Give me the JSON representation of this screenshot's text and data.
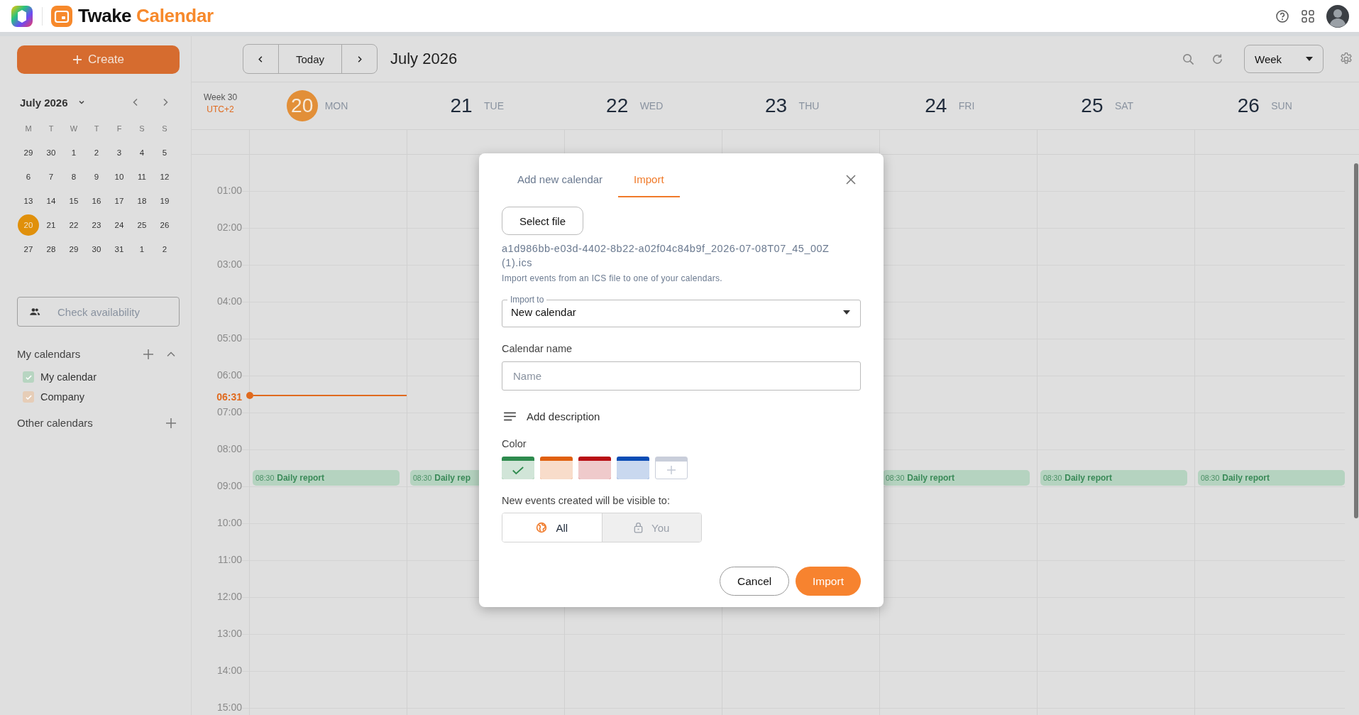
{
  "app": {
    "brand": "Twake",
    "product": "Calendar"
  },
  "sidebar": {
    "create_label": "Create",
    "mini_calendar": {
      "title": "July 2026",
      "weekdays": [
        "M",
        "T",
        "W",
        "T",
        "F",
        "S",
        "S"
      ],
      "weeks": [
        [
          {
            "day": "29",
            "selected": false
          },
          {
            "day": "30",
            "selected": false
          },
          {
            "day": "1",
            "selected": false
          },
          {
            "day": "2",
            "selected": false
          },
          {
            "day": "3",
            "selected": false
          },
          {
            "day": "4",
            "selected": false
          },
          {
            "day": "5",
            "selected": false
          }
        ],
        [
          {
            "day": "6",
            "selected": false
          },
          {
            "day": "7",
            "selected": false
          },
          {
            "day": "8",
            "selected": false
          },
          {
            "day": "9",
            "selected": false
          },
          {
            "day": "10",
            "selected": false
          },
          {
            "day": "11",
            "selected": false
          },
          {
            "day": "12",
            "selected": false
          }
        ],
        [
          {
            "day": "13",
            "selected": false
          },
          {
            "day": "14",
            "selected": false
          },
          {
            "day": "15",
            "selected": false
          },
          {
            "day": "16",
            "selected": false
          },
          {
            "day": "17",
            "selected": false
          },
          {
            "day": "18",
            "selected": false
          },
          {
            "day": "19",
            "selected": false
          }
        ],
        [
          {
            "day": "20",
            "selected": true
          },
          {
            "day": "21",
            "selected": false
          },
          {
            "day": "22",
            "selected": false
          },
          {
            "day": "23",
            "selected": false
          },
          {
            "day": "24",
            "selected": false
          },
          {
            "day": "25",
            "selected": false
          },
          {
            "day": "26",
            "selected": false
          }
        ],
        [
          {
            "day": "27",
            "selected": false
          },
          {
            "day": "28",
            "selected": false
          },
          {
            "day": "29",
            "selected": false
          },
          {
            "day": "30",
            "selected": false
          },
          {
            "day": "31",
            "selected": false
          },
          {
            "day": "1",
            "selected": false
          },
          {
            "day": "2",
            "selected": false
          }
        ]
      ]
    },
    "check_availability": "Check availability",
    "my_calendars": {
      "title": "My calendars",
      "expanded": true,
      "items": [
        {
          "name": "My calendar",
          "checked": true,
          "color": "#b7d5c1"
        },
        {
          "name": "Company",
          "checked": true,
          "color": "#e6cdb7"
        }
      ]
    },
    "other_calendars": {
      "title": "Other calendars"
    }
  },
  "toolbar": {
    "today": "Today",
    "period": "July 2026",
    "view": "Week"
  },
  "week": {
    "week_label": "Week 30",
    "timezone": "UTC+2",
    "now": "06:31",
    "hours": [
      "01:00",
      "02:00",
      "03:00",
      "04:00",
      "05:00",
      "06:00",
      "07:00",
      "08:00",
      "09:00",
      "10:00",
      "11:00",
      "12:00",
      "13:00",
      "14:00",
      "15:00"
    ],
    "days": [
      {
        "number": "20",
        "weekday": "MON",
        "today": true,
        "events": [
          {
            "time": "08:30",
            "title": "Daily report"
          }
        ]
      },
      {
        "number": "21",
        "weekday": "TUE",
        "today": false,
        "events": [
          {
            "time": "08:30",
            "title": "Daily rep"
          }
        ]
      },
      {
        "number": "22",
        "weekday": "WED",
        "today": false
      },
      {
        "number": "23",
        "weekday": "THU",
        "today": false
      },
      {
        "number": "24",
        "weekday": "FRI",
        "today": false,
        "events": [
          {
            "time": "08:30",
            "title": "Daily report"
          }
        ]
      },
      {
        "number": "25",
        "weekday": "SAT",
        "today": false,
        "events": [
          {
            "time": "08:30",
            "title": "Daily report"
          }
        ]
      },
      {
        "number": "26",
        "weekday": "SUN",
        "today": false,
        "events": [
          {
            "time": "08:30",
            "title": "Daily report"
          }
        ]
      }
    ]
  },
  "dialog": {
    "tabs": [
      {
        "label": "Add new calendar",
        "selected": false
      },
      {
        "label": "Import",
        "selected": true
      }
    ],
    "select_file": "Select file",
    "file_name": "a1d986bb-e03d-4402-8b22-a02f04c84b9f_2026-07-08T07_45_00Z (1).ics",
    "hint": "Import events from an ICS file to one of your calendars.",
    "import_to": {
      "label": "Import to",
      "value": "New calendar"
    },
    "calendar_name": {
      "label": "Calendar name",
      "placeholder": "Name"
    },
    "add_description": "Add description",
    "color_label": "Color",
    "colors": [
      {
        "kind": "swatch",
        "color": "#2e8b4e",
        "selected": true
      },
      {
        "kind": "swatch",
        "color": "#e0600f",
        "selected": false
      },
      {
        "kind": "swatch",
        "color": "#b80f14",
        "selected": false
      },
      {
        "kind": "swatch",
        "color": "#0b4db5",
        "selected": false
      },
      {
        "kind": "add",
        "selected": false
      }
    ],
    "visibility_label": "New events created will be visible to:",
    "visibility": [
      {
        "kind": "all",
        "label": "All",
        "selected": true
      },
      {
        "kind": "you",
        "label": "You",
        "selected": false
      }
    ],
    "buttons": [
      {
        "kind": "secondary",
        "label": "Cancel"
      },
      {
        "kind": "primary",
        "label": "Import"
      }
    ]
  }
}
